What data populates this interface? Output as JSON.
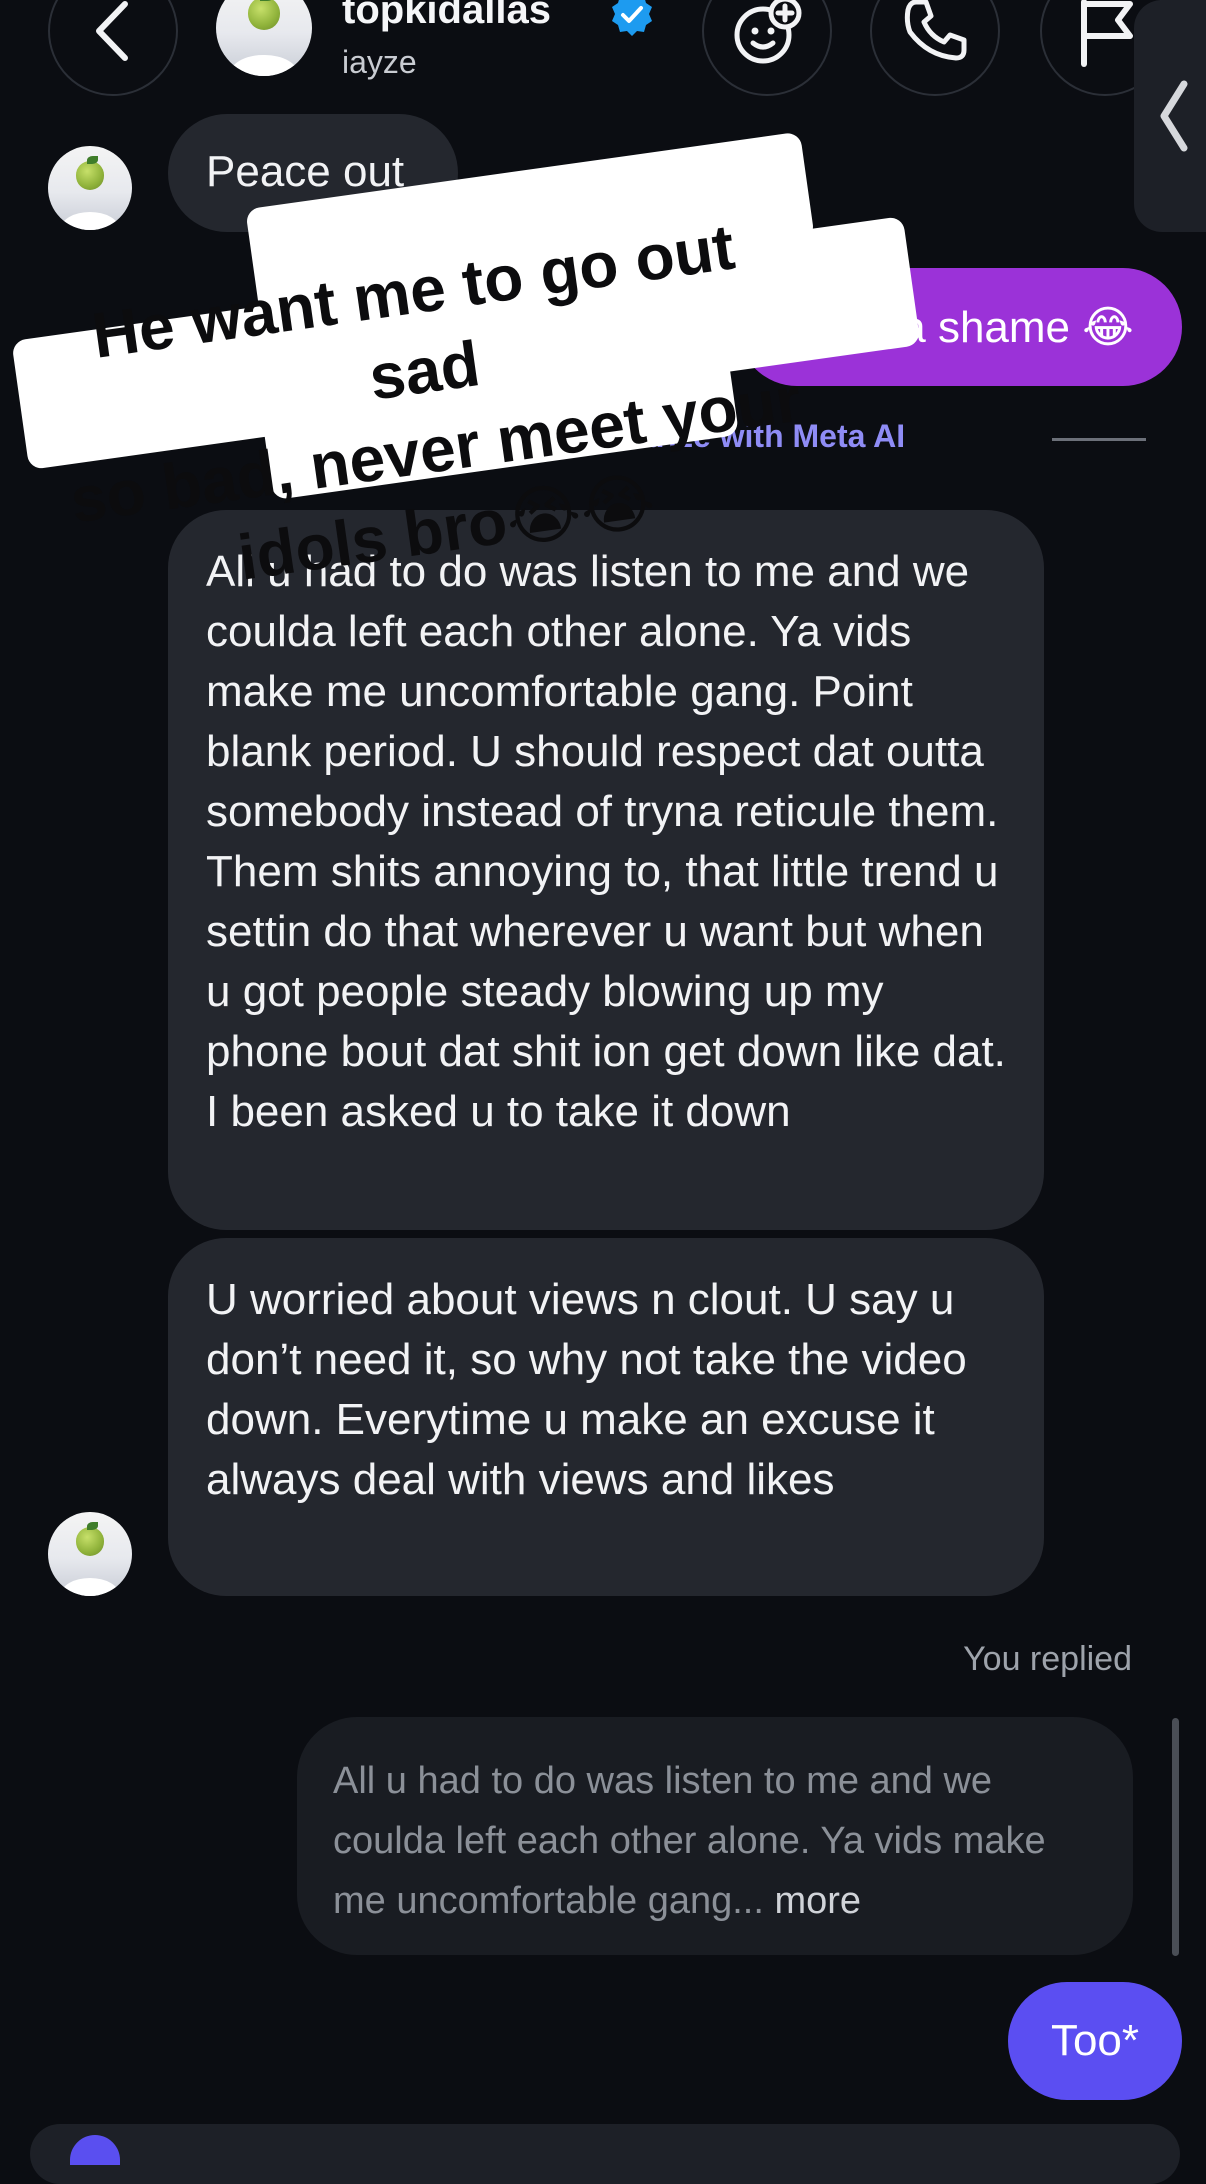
{
  "header": {
    "username": "topkidallas",
    "handle": "iayze",
    "back_icon": "chevron-left-icon",
    "effects_icon": "face-plus-icon",
    "call_icon": "phone-icon",
    "flag_icon": "flag-icon",
    "side_tab_icon": "chevron-left-icon"
  },
  "messages": {
    "peace_out": "Peace out",
    "what_a_shame": "What a shame 😂",
    "summarize": "Summarize with Meta AI",
    "long_message_1": "All u had to do was listen to me and we coulda left each other alone. Ya vids make me uncomfortable gang. Point blank period. U should respect dat outta somebody instead of tryna reticule them. Them shits annoying to, that little trend u settin do that wherever u want but when u got people steady blowing up my phone bout dat shit ion get down like dat. I been asked u to take it down",
    "long_message_2": "U worried about views n clout. U say u don’t need it, so why not take the video down. Everytime u make an excuse it always deal with views and likes",
    "you_replied": "You replied",
    "reply_quote": "All u had to do was listen to me and we coulda left each other alone. Ya vids make me uncomfortable gang...",
    "reply_more": "more",
    "too": "Too*"
  },
  "overlay": {
    "caption_line1": "He want me to go out sad",
    "caption_line2": "so bad, never meet your",
    "caption_line3": "idols bro😭😭"
  },
  "colors": {
    "background": "#0b0d12",
    "incoming_bubble": "#24272e",
    "purple_bubble": "#9b32d8",
    "blue_bubble": "#5b4ef2",
    "accent_link": "#8f8cf5",
    "verified": "#1d9bf0"
  }
}
